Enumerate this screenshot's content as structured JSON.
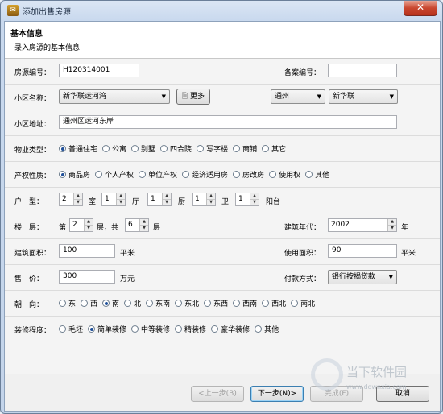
{
  "window": {
    "title": "添加出售房源",
    "close": "✕"
  },
  "header": {
    "title": "基本信息",
    "subtitle": "录入房源的基本信息"
  },
  "form": {
    "house_no": {
      "label": "房源编号：",
      "value": "H120314001"
    },
    "record_no": {
      "label": "备案编号：",
      "value": ""
    },
    "community": {
      "label": "小区名称：",
      "value": "新华联运河湾",
      "more": "更多",
      "district": "通州",
      "area": "新华联"
    },
    "address": {
      "label": "小区地址：",
      "value": "通州区运河东岸"
    },
    "property_type": {
      "label": "物业类型：",
      "options": [
        "普通住宅",
        "公寓",
        "别墅",
        "四合院",
        "写字楼",
        "商铺",
        "其它"
      ],
      "selected": "普通住宅"
    },
    "ownership": {
      "label": "产权性质：",
      "options": [
        "商品房",
        "个人产权",
        "单位产权",
        "经济适用房",
        "房改房",
        "使用权",
        "其他"
      ],
      "selected": "商品房"
    },
    "layout": {
      "label": "户　型：",
      "room": "2",
      "room_unit": "室",
      "hall": "1",
      "hall_unit": "厅",
      "kitchen": "1",
      "kitchen_unit": "厨",
      "bath": "1",
      "bath_unit": "卫",
      "balcony": "1",
      "balcony_unit": "阳台"
    },
    "floor": {
      "label": "楼　层：",
      "prefix": "第",
      "floor": "2",
      "mid": "层，共",
      "total": "6",
      "suffix": "层",
      "year_label": "建筑年代：",
      "year": "2002",
      "year_unit": "年"
    },
    "area": {
      "label": "建筑面积：",
      "value": "100",
      "unit": "平米",
      "use_label": "使用面积：",
      "use_value": "90",
      "use_unit": "平米"
    },
    "price": {
      "label": "售　价：",
      "value": "300",
      "unit": "万元",
      "pay_label": "付款方式：",
      "pay_value": "银行按揭贷款"
    },
    "orientation": {
      "label": "朝　向：",
      "options": [
        "东",
        "西",
        "南",
        "北",
        "东南",
        "东北",
        "东西",
        "西南",
        "西北",
        "南北"
      ],
      "selected": "南"
    },
    "decoration": {
      "label": "装修程度：",
      "options": [
        "毛坯",
        "简单装修",
        "中等装修",
        "精装修",
        "豪华装修",
        "其他"
      ],
      "selected": "简单装修"
    }
  },
  "footer": {
    "prev": "<上一步(B)",
    "next": "下一步(N)>",
    "finish": "完成(F)",
    "cancel": "取消"
  },
  "watermark": {
    "text": "当下软件园",
    "url": "www.downxia.com"
  }
}
